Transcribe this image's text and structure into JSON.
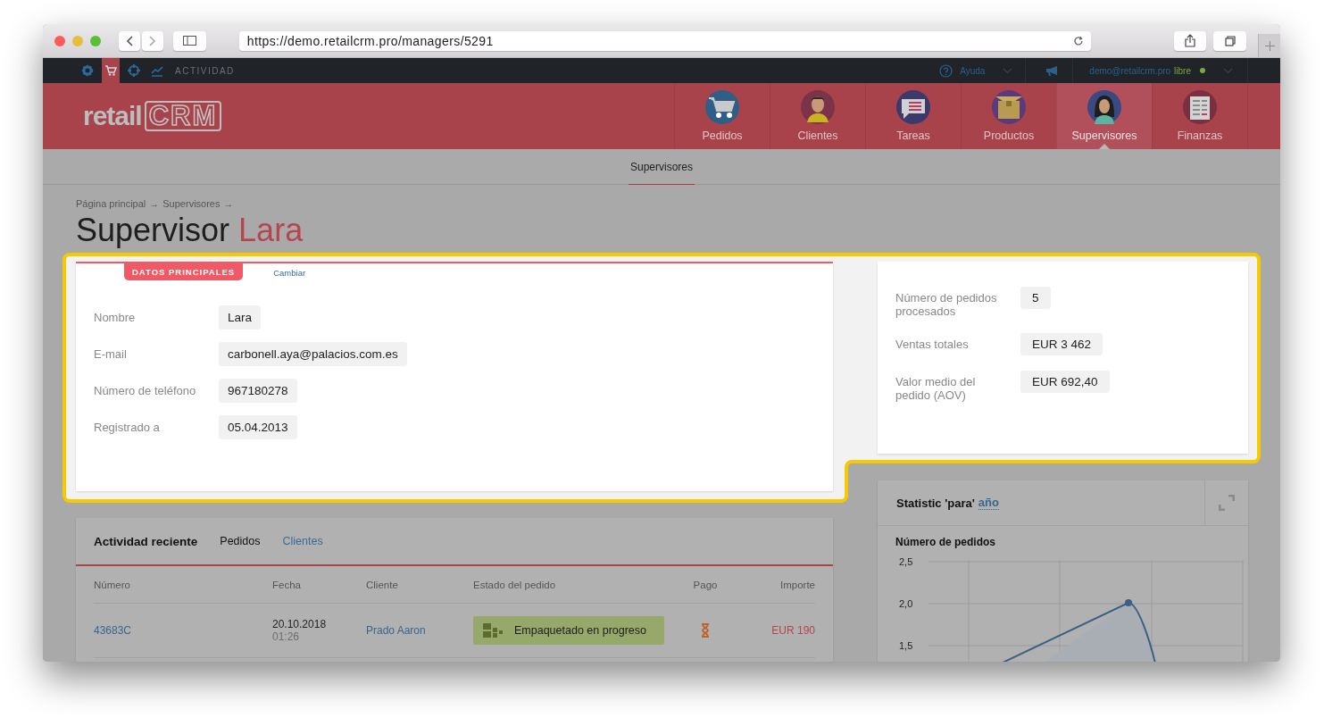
{
  "browser": {
    "url": "https://demo.retailcrm.pro/managers/5291"
  },
  "top_bar": {
    "icons": [
      {
        "kind": "gear",
        "selected": false
      },
      {
        "kind": "cart",
        "selected": true
      },
      {
        "kind": "target",
        "selected": false
      },
      {
        "kind": "chart",
        "selected": false
      }
    ],
    "section": "ACTIVIDAD",
    "help": "Ayuda",
    "user_email": "demo@retailcrm.pro",
    "plan": "libre"
  },
  "logo": {
    "prefix": "retail",
    "suffix": "CRM"
  },
  "nav": [
    {
      "label": "Pedidos",
      "kind": "cart",
      "selected": false
    },
    {
      "label": "Clientes",
      "kind": "person",
      "selected": false
    },
    {
      "label": "Tareas",
      "kind": "chat",
      "selected": false
    },
    {
      "label": "Productos",
      "kind": "box",
      "selected": false
    },
    {
      "label": "Supervisores",
      "kind": "woman",
      "selected": true
    },
    {
      "label": "Finanzas",
      "kind": "ledger",
      "selected": false
    }
  ],
  "sub_nav": [
    {
      "label": "Supervisores",
      "selected": true
    }
  ],
  "breadcrumb": [
    {
      "label": "Página principal",
      "separator": "→"
    },
    {
      "label": "Supervisores",
      "separator": "→"
    }
  ],
  "title": {
    "prefix": "Supervisor",
    "name": "Lara"
  },
  "profile": {
    "tabs": [
      {
        "label": "DATOS PRINCIPALES",
        "selected": true
      },
      {
        "label": "Cambiar",
        "selected": false
      }
    ],
    "fields": [
      {
        "label": "Nombre",
        "value": "Lara"
      },
      {
        "label": "E-mail",
        "value": "carbonell.aya@palacios.com.es"
      },
      {
        "label": "Número de teléfono",
        "value": "967180278"
      },
      {
        "label": "Registrado a",
        "value": "05.04.2013"
      }
    ]
  },
  "stats": [
    {
      "label": "Número de pedidos procesados",
      "value": "5"
    },
    {
      "label": "Ventas totales",
      "value": "EUR 3 462"
    },
    {
      "label": "Valor medio del pedido (AOV)",
      "value": "EUR 692,40"
    }
  ],
  "activity": {
    "title": "Actividad reciente",
    "tabs": [
      {
        "label": "Pedidos",
        "selected": true
      },
      {
        "label": "Clientes",
        "selected": false
      }
    ],
    "columns": [
      "Número",
      "Fecha",
      "Cliente",
      "Estado del pedido",
      "Pago",
      "Importe"
    ],
    "rows": [
      {
        "number": "43683C",
        "date": "20.10.2018",
        "time": "01:26",
        "client": "Prado Aaron",
        "status": "Empaquetado en progreso",
        "payment": {
          "kind": "pending"
        },
        "amount": "EUR 190"
      }
    ]
  },
  "chart": {
    "title": "Statistic 'para'",
    "period": "año",
    "metric": "Número de pedidos",
    "y_ticks": [
      "2,5",
      "2,0",
      "1,5"
    ]
  }
}
